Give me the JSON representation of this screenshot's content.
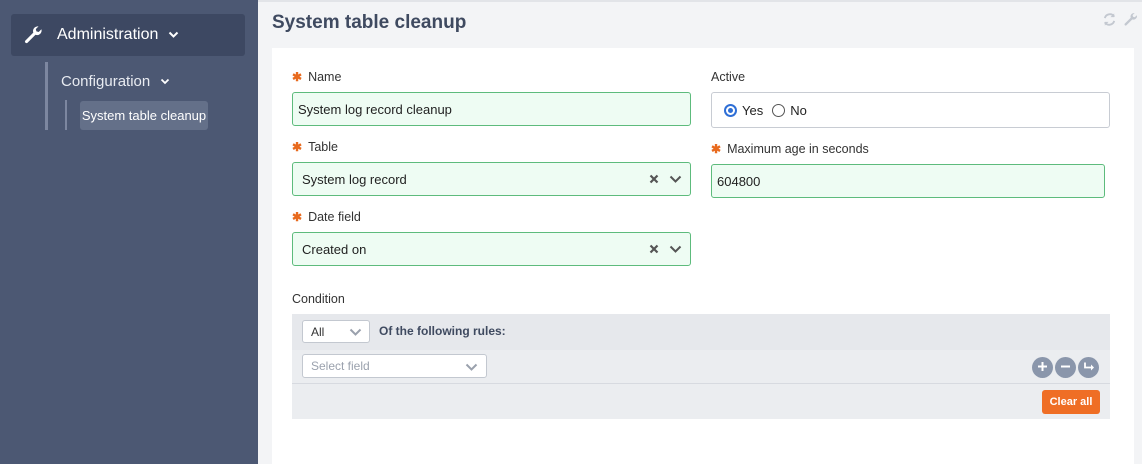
{
  "sidebar": {
    "admin_label": "Administration",
    "config_label": "Configuration",
    "active_item_label": "System table cleanup"
  },
  "page": {
    "title": "System table cleanup"
  },
  "form": {
    "name": {
      "label": "Name",
      "value": "System log record cleanup"
    },
    "active": {
      "label": "Active",
      "options": [
        "Yes",
        "No"
      ],
      "selected": "Yes"
    },
    "table": {
      "label": "Table",
      "value": "System log record"
    },
    "max_age": {
      "label": "Maximum age in seconds",
      "value": "604800"
    },
    "date_field": {
      "label": "Date field",
      "value": "Created on"
    },
    "condition": {
      "label": "Condition",
      "match_value": "All",
      "rules_text": "Of the following rules:",
      "field_placeholder": "Select field",
      "clear_label": "Clear all"
    }
  },
  "colors": {
    "sidebar_bg": "#4c5873",
    "accent_orange": "#ef6e25",
    "valid_border": "#5dbb7c",
    "radio_blue": "#2f6fd6"
  },
  "icons": [
    "wrench-icon",
    "chevron-down-icon",
    "refresh-icon",
    "clear-x-icon",
    "plus-icon",
    "minus-icon",
    "subgroup-arrow-icon"
  ]
}
